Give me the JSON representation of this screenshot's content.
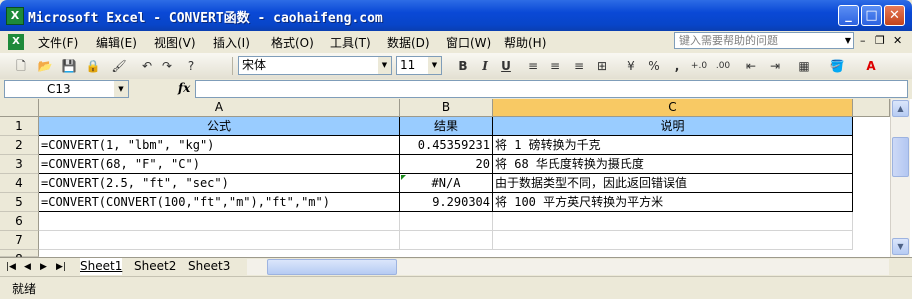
{
  "window": {
    "title": "Microsoft Excel - CONVERT函数 - caohaifeng.com"
  },
  "menu": {
    "items": [
      "文件(F)",
      "编辑(E)",
      "视图(V)",
      "插入(I)",
      "格式(O)",
      "工具(T)",
      "数据(D)",
      "窗口(W)",
      "帮助(H)"
    ],
    "help_placeholder": "键入需要帮助的问题"
  },
  "toolbar": {
    "font_name": "宋体",
    "font_size": "11",
    "bold": "B",
    "italic": "I",
    "underline": "U",
    "percent": "%",
    "comma": ","
  },
  "formula_bar": {
    "name_box": "C13",
    "fx": "fx",
    "formula": ""
  },
  "grid": {
    "columns": [
      "A",
      "B",
      "C"
    ],
    "selected_column": "C",
    "rows": [
      "1",
      "2",
      "3",
      "4",
      "5",
      "6",
      "7",
      "8"
    ],
    "header": [
      "公式",
      "结果",
      "说明"
    ],
    "data": [
      [
        "=CONVERT(1, \"lbm\", \"kg\")",
        "0.45359231",
        "将 1 磅转换为千克"
      ],
      [
        "=CONVERT(68, \"F\", \"C\")",
        "20",
        "将 68 华氏度转换为摄氏度"
      ],
      [
        "=CONVERT(2.5, \"ft\", \"sec\")",
        "#N/A",
        "由于数据类型不同，因此返回错误值"
      ],
      [
        "=CONVERT(CONVERT(100,\"ft\",\"m\"),\"ft\",\"m\")",
        "9.290304",
        "将 100 平方英尺转换为平方米"
      ]
    ]
  },
  "sheets": {
    "tabs": [
      "Sheet1",
      "Sheet2",
      "Sheet3"
    ],
    "active": "Sheet1"
  },
  "status": {
    "text": "就绪"
  }
}
